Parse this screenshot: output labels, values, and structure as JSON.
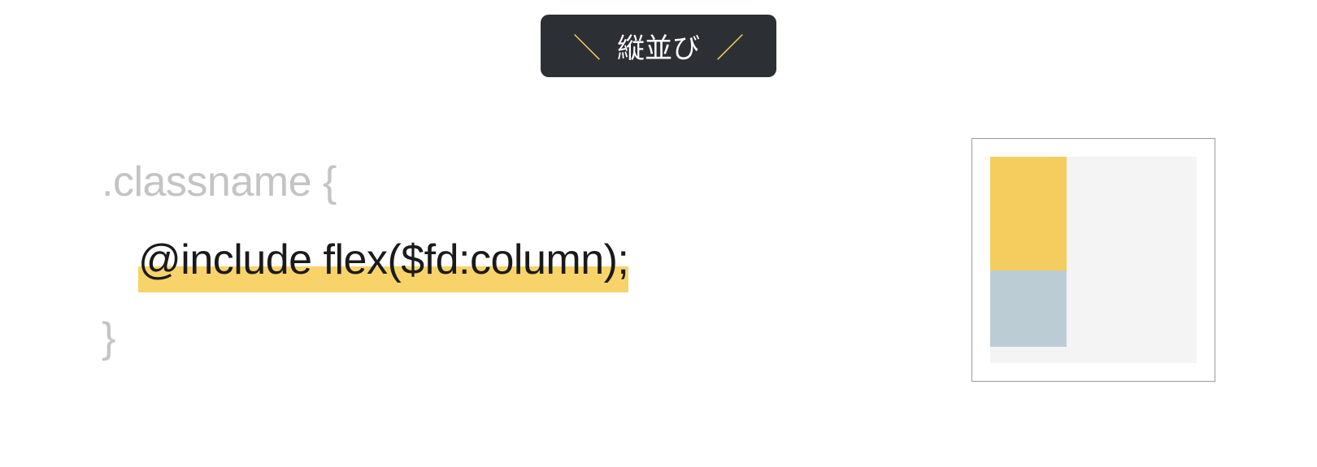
{
  "header": {
    "label": "縦並び"
  },
  "code": {
    "line1": ".classname {",
    "line2": "@include flex($fd:column);",
    "line3": "}"
  },
  "preview": {
    "layout": "column"
  }
}
